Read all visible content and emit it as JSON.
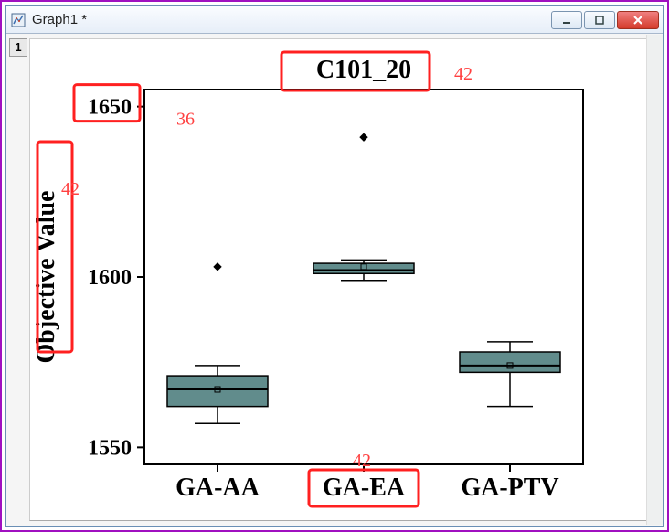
{
  "window": {
    "title": "Graph1 *",
    "tab_marker": "1"
  },
  "annotations": {
    "a_title": "42",
    "a_ytick": "36",
    "a_ylabel": "42",
    "a_xtick": "42"
  },
  "chart_data": {
    "type": "boxplot",
    "title": "C101_20",
    "ylabel": "Objective Value",
    "xlabel": "",
    "y_ticks": [
      1550,
      1600,
      1650
    ],
    "ylim": [
      1545,
      1655
    ],
    "categories": [
      "GA-AA",
      "GA-EA",
      "GA-PTV"
    ],
    "series": [
      {
        "name": "GA-AA",
        "q1": 1562,
        "median": 1567,
        "q3": 1571,
        "whisker_low": 1557,
        "whisker_high": 1574,
        "mean": 1567,
        "outliers": [
          1603
        ]
      },
      {
        "name": "GA-EA",
        "q1": 1601,
        "median": 1602,
        "q3": 1604,
        "whisker_low": 1599,
        "whisker_high": 1605,
        "mean": 1603,
        "outliers": [
          1641
        ]
      },
      {
        "name": "GA-PTV",
        "q1": 1572,
        "median": 1574,
        "q3": 1578,
        "whisker_low": 1562,
        "whisker_high": 1581,
        "mean": 1574,
        "outliers": []
      }
    ]
  }
}
